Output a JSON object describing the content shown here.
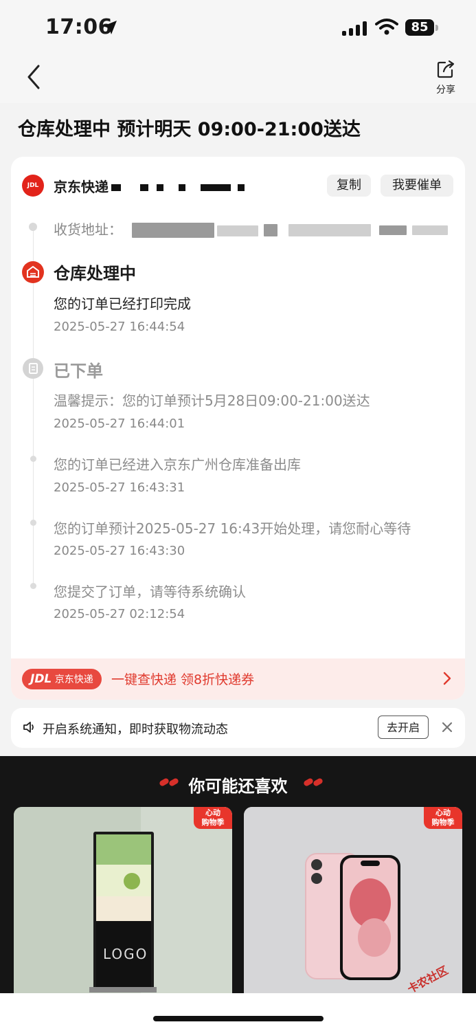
{
  "status_bar": {
    "time": "17:06",
    "battery": "85"
  },
  "nav": {
    "share_label": "分享"
  },
  "page_title": "仓库处理中 预计明天 09:00-21:00送达",
  "carrier": {
    "logo_text": "JDL",
    "name_visible": "京东快递",
    "copy_label": "复制",
    "urge_label": "我要催单"
  },
  "address": {
    "label": "收货地址："
  },
  "timeline": {
    "warehouse": {
      "title": "仓库处理中",
      "event": "您的订单已经打印完成",
      "time": "2025-05-27 16:44:54"
    },
    "ordered": {
      "title": "已下单",
      "event": "温馨提示：您的订单预计5月28日09:00-21:00送达",
      "time": "2025-05-27 16:44:01"
    },
    "events": [
      {
        "text": "您的订单已经进入京东广州仓库准备出库",
        "time": "2025-05-27 16:43:31"
      },
      {
        "text": "您的订单预计2025-05-27 16:43开始处理，请您耐心等待",
        "time": "2025-05-27 16:43:30"
      },
      {
        "text": "您提交了订单，请等待系统确认",
        "time": "2025-05-27 02:12:54"
      }
    ]
  },
  "promo": {
    "pill_brand": "JDL",
    "pill_label": "京东快递",
    "text": "一键查快递  领8折快递券"
  },
  "notify": {
    "text": "开启系统通知，即时获取物流动态",
    "button": "去开启"
  },
  "recommend": {
    "title": "你可能还喜欢",
    "tag_line1": "心动",
    "tag_line2": "购物季",
    "product1_logo": "LOGO"
  },
  "watermark": "卡农社区",
  "colors": {
    "accent_red": "#e2231a",
    "promo_bg": "#fdecea"
  }
}
